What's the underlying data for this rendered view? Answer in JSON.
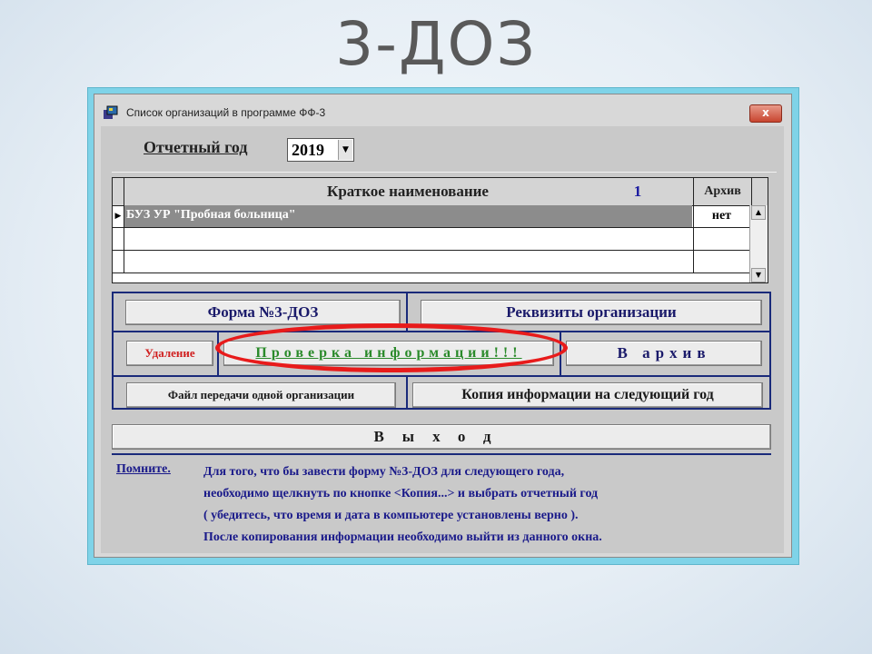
{
  "slide": {
    "title": "3-ДОЗ"
  },
  "window": {
    "title": "Список организаций в программе ФФ-3",
    "close_label": "x"
  },
  "year": {
    "label": "Отчетный год",
    "value": "2019",
    "arrow": "▼"
  },
  "table": {
    "columns": {
      "name": "Краткое наименование",
      "count": "1",
      "archive": "Архив"
    },
    "rows": [
      {
        "indicator": "▶",
        "name": "БУЗ УР \"Пробная больница\"",
        "archive": "нет",
        "selected": true
      },
      {
        "indicator": "",
        "name": "",
        "archive": "",
        "selected": false
      },
      {
        "indicator": "",
        "name": "",
        "archive": "",
        "selected": false
      }
    ],
    "scroll_up": "▲",
    "scroll_down": "▼"
  },
  "buttons": {
    "form": "Форма №3-ДОЗ",
    "requisites": "Реквизиты организации",
    "delete": "Удаление",
    "check": "Проверка информации!!!",
    "archive": "В архив",
    "file_transfer": "Файл передачи одной организации",
    "copy_next_year": "Копия информации на следующий год",
    "exit": "Выход"
  },
  "note": {
    "label": "Помните.",
    "lines": [
      "Для того, что бы завести форму №3-ДОЗ для следующего года,",
      "необходимо щелкнуть по кнопке <Копия...> и выбрать отчетный год",
      "( убедитесь, что время и дата в компьютере установлены верно ).",
      "После копирования информации необходимо выйти из данного окна."
    ]
  },
  "colors": {
    "accent_navy": "#1a2a7a",
    "highlight_red": "#e81b1b",
    "check_green": "#2a8a2a",
    "delete_red": "#d02020"
  }
}
